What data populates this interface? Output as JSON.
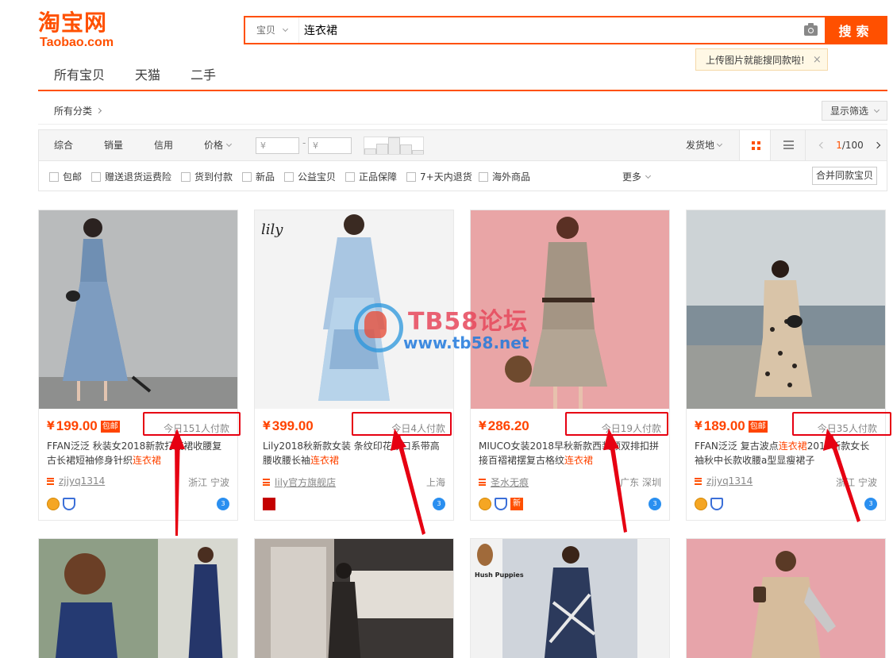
{
  "logo": {
    "cn": "淘宝网",
    "en": "Taobao.com"
  },
  "search": {
    "category": "宝贝",
    "query": "连衣裙",
    "button": "搜索"
  },
  "tip": {
    "text": "上传图片就能搜同款啦!",
    "close": "×"
  },
  "tabs": [
    "所有宝贝",
    "天猫",
    "二手"
  ],
  "breadcrumb": "所有分类",
  "filter_toggle": "显示筛选",
  "sort": {
    "items": [
      "综合",
      "销量",
      "信用",
      "价格"
    ],
    "price_from": "¥",
    "price_to": "¥",
    "dash": "-",
    "ship_from": "发货地",
    "page_current": "1",
    "page_total": "/100"
  },
  "options": [
    "包邮",
    "赠送退货运费险",
    "货到付款",
    "新品",
    "公益宝贝",
    "正品保障",
    "7+天内退货",
    "海外商品"
  ],
  "more": "更多",
  "merge": "合并同款宝贝",
  "products": [
    {
      "price": "199.00",
      "free": "包邮",
      "sales": "今日151人付款",
      "title_pre": "FFAN泛泛 秋装女2018新款打底裙收腰复古长裙短袖修身针织",
      "title_kw": "连衣裙",
      "title_post": "",
      "shop": "zjjyq1314",
      "loc": "浙江 宁波"
    },
    {
      "price": "399.00",
      "free": "",
      "sales": "今日4人付款",
      "title_pre": "Lily2018秋新款女装 条纹印花领口系带高腰收腰长袖",
      "title_kw": "连衣裙",
      "title_post": "",
      "shop": "lily官方旗舰店",
      "loc": "上海"
    },
    {
      "price": "286.20",
      "free": "",
      "sales": "今日19人付款",
      "title_pre": "MIUCO女装2018早秋新款西装领双排扣拼接百褶裙摆复古格纹",
      "title_kw": "连衣裙",
      "title_post": "",
      "shop": "圣水无痕",
      "loc": "广东 深圳"
    },
    {
      "price": "189.00",
      "free": "包邮",
      "sales": "今日35人付款",
      "title_pre": "FFAN泛泛 复古波点",
      "title_kw": "连衣裙",
      "title_post": "2018新款女长袖秋中长款收腰a型显瘦裙子",
      "shop": "zjjyq1314",
      "loc": "浙江 宁波"
    }
  ],
  "currency": "¥",
  "product_images": [
    "woman in blue pleated knit dress",
    "woman in light blue printed dress",
    "woman in plaid trench-style dress",
    "woman in polka dot dress by the sea"
  ],
  "watermark": {
    "line1": "TB58论坛",
    "line2": "www.tb58.net"
  },
  "colors": {
    "accent": "#ff5000",
    "price": "#ff4400",
    "annotation": "#e60012"
  }
}
